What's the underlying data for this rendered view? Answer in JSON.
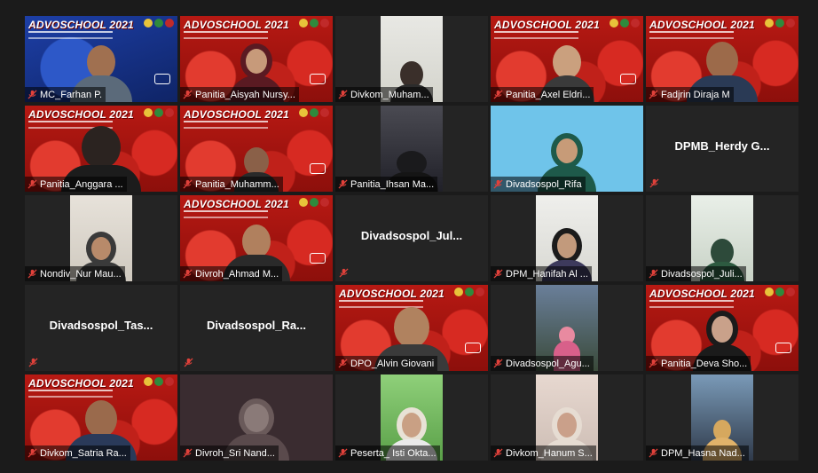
{
  "banner": {
    "title": "ADVOSCHOOL 2021"
  },
  "participants": [
    {
      "name": "MC_Farhan P."
    },
    {
      "name": "Panitia_Aisyah Nursy..."
    },
    {
      "name": "Divkom_Muham..."
    },
    {
      "name": "Panitia_Axel Eldri..."
    },
    {
      "name": "Fadjrin Diraja M"
    },
    {
      "name": "Panitia_Anggara ..."
    },
    {
      "name": "Panitia_Muhamm..."
    },
    {
      "name": "Panitia_Ihsan Ma..."
    },
    {
      "name": "Divadsospol_Rifa"
    },
    {
      "name": "DPMB_Herdy  G..."
    },
    {
      "name": "Nondiv_Nur Mau..."
    },
    {
      "name": "Divroh_Ahmad M..."
    },
    {
      "name": "Divadsospol_Jul..."
    },
    {
      "name": "DPM_Hanifah Al ..."
    },
    {
      "name": "Divadsospol_Juli..."
    },
    {
      "name": "Divadsospol_Tas..."
    },
    {
      "name": "Divadsospol_Ra..."
    },
    {
      "name": "DPO_Alvin Giovani"
    },
    {
      "name": "Divadsospol_Agu..."
    },
    {
      "name": "Panitia_Deva Sho..."
    },
    {
      "name": "Divkom_Satria Ra..."
    },
    {
      "name": "Divroh_Sri Nand..."
    },
    {
      "name": "Peserta_ Isti Okta..."
    },
    {
      "name": "Divkom_Hanum S..."
    },
    {
      "name": "DPM_Hasna Nad..."
    }
  ],
  "colors": {
    "active_speaker": "#e9d84a",
    "mic_muted": "#e0413a",
    "tile_bg": "#262626"
  }
}
